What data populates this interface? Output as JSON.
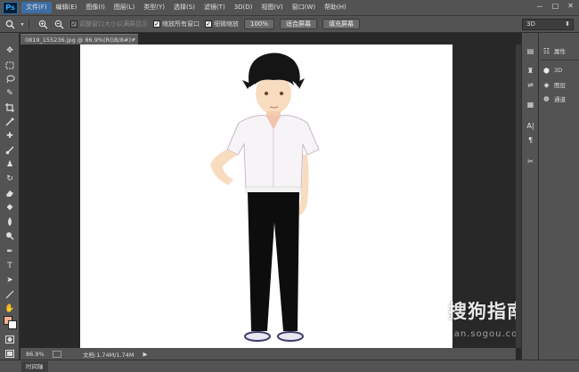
{
  "app": {
    "logo": "Ps"
  },
  "menu": {
    "items": [
      "文件(F)",
      "编辑(E)",
      "图像(I)",
      "图层(L)",
      "类型(Y)",
      "选择(S)",
      "滤镜(T)",
      "3D(D)",
      "视图(V)",
      "窗口(W)",
      "帮助(H)"
    ],
    "active_index": 0,
    "window_controls": [
      "－",
      "□",
      "✕"
    ]
  },
  "options": {
    "checkboxes": [
      {
        "label": "调整窗口大小以满屏显示",
        "checked": true,
        "disabled": true
      },
      {
        "label": "缩放所有窗口",
        "checked": true,
        "disabled": false
      },
      {
        "label": "细微缩放",
        "checked": true,
        "disabled": false
      }
    ],
    "zoom_button": "100%",
    "fit_button": "适合屏幕",
    "fill_button": "填充屏幕",
    "workspace": "3D"
  },
  "document": {
    "tab_title": "0819_155236.jpg @ 86.9%(RGB/8#) *",
    "close": "×"
  },
  "status": {
    "zoom": "86.9%",
    "doc_info": "文档:1.74M/1.74M",
    "arrow": "▶"
  },
  "timeline": {
    "label": "时间轴"
  },
  "dock": {
    "items": [
      {
        "icon": "properties-icon",
        "label": "属性"
      },
      {
        "icon": "3d-icon",
        "label": "3D"
      },
      {
        "icon": "layers-icon",
        "label": "图层"
      },
      {
        "icon": "channels-icon",
        "label": "通道"
      }
    ]
  },
  "watermark": {
    "text": "搜狗指南",
    "url": "zhinan.sogou.com"
  },
  "colors": {
    "foreground": "#f0b090",
    "background": "#ffffff",
    "ui_panel": "#535353",
    "workspace": "#282828",
    "menu_active": "#3c6ea5"
  }
}
